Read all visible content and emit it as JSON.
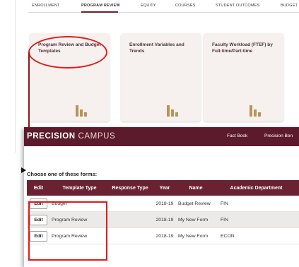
{
  "dashboard": {
    "tabs": [
      {
        "label": "ENROLLMENT"
      },
      {
        "label": "PROGRAM REVIEW"
      },
      {
        "label": "EQUITY"
      },
      {
        "label": "COURSES"
      },
      {
        "label": "STUDENT OUTCOMES"
      },
      {
        "label": "BUDGET"
      }
    ],
    "active_tab": "PROGRAM REVIEW",
    "cards": [
      {
        "title": "Program Review and Budget Templates",
        "icon": "bar-chart-icon"
      },
      {
        "title": "Enrollment Variables and Trends",
        "icon": "bar-chart-icon"
      },
      {
        "title": "Faculty Workload (FTEF) by Full-time/Part-time",
        "icon": "bar-chart-icon"
      }
    ]
  },
  "forms_page": {
    "logo": {
      "bold": "PRECISI",
      "bold_o": "O",
      "bold_n": "N",
      "light": " CAMPUS"
    },
    "header_links": [
      "Fact Book",
      "Precision Ben"
    ],
    "prompt": "Choose one of these forms:",
    "columns": [
      "Edit",
      "Template Type",
      "Response Type",
      "Year",
      "Name",
      "Academic Department"
    ],
    "rows": [
      {
        "edit": "Edit",
        "template_type": "Budget",
        "response_type": "",
        "year": "2018-19",
        "name": "Budget Review",
        "department": "FIN"
      },
      {
        "edit": "Edit",
        "template_type": "Program Review",
        "response_type": "",
        "year": "2018-19",
        "name": "My New Form",
        "department": "FIN"
      },
      {
        "edit": "Edit",
        "template_type": "Program Review",
        "response_type": "",
        "year": "2018-19",
        "name": "My New Form",
        "department": "ECON"
      }
    ]
  },
  "colors": {
    "brand_maroon": "#5c1b2c",
    "table_header": "#6a2233",
    "callout_red": "#e21a1a",
    "card_bg": "#f6f1ee",
    "icon_gold": "#b6955a"
  }
}
